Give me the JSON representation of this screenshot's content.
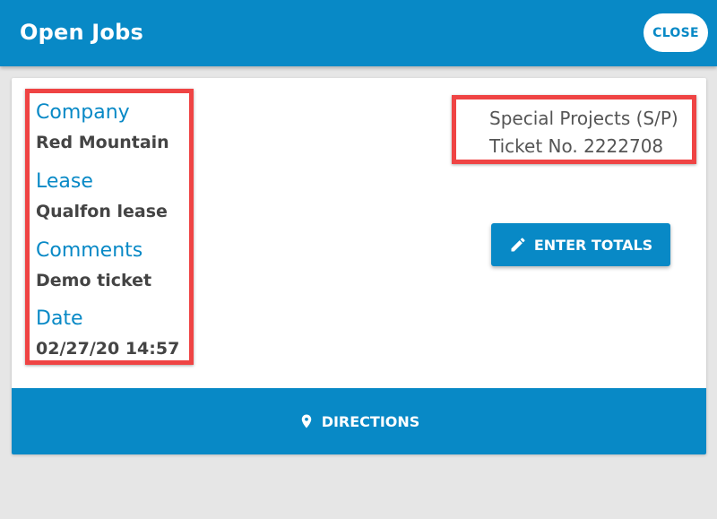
{
  "header": {
    "title": "Open Jobs",
    "close_label": "CLOSE"
  },
  "job": {
    "fields": {
      "company": {
        "label": "Company",
        "value": "Red Mountain"
      },
      "lease": {
        "label": "Lease",
        "value": "Qualfon lease"
      },
      "comments": {
        "label": "Comments",
        "value": "Demo ticket"
      },
      "date": {
        "label": "Date",
        "value": "02/27/20 14:57"
      }
    },
    "service": "Special Projects (S/P)",
    "ticket": "Ticket No. 2222708"
  },
  "actions": {
    "enter_totals_label": "ENTER TOTALS",
    "directions_label": "DIRECTIONS"
  },
  "icons": {
    "enter_totals": "pencil-icon",
    "directions": "map-pin-icon"
  },
  "colors": {
    "primary": "#0889c6",
    "highlight": "#ef4444",
    "background": "#e6e6e6"
  }
}
